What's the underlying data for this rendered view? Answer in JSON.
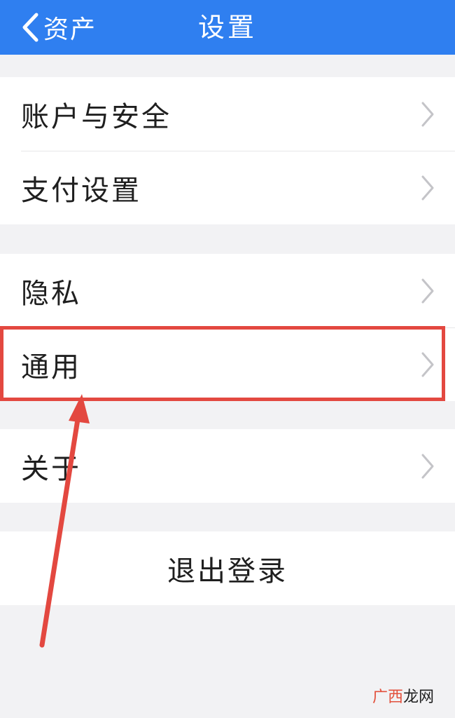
{
  "header": {
    "back_label": "资产",
    "title": "设置"
  },
  "groups": [
    {
      "items": [
        {
          "label": "账户与安全"
        },
        {
          "label": "支付设置"
        }
      ]
    },
    {
      "items": [
        {
          "label": "隐私"
        },
        {
          "label": "通用"
        }
      ]
    },
    {
      "items": [
        {
          "label": "关于"
        }
      ]
    }
  ],
  "logout_label": "退出登录",
  "highlight_target": "通用",
  "watermark": {
    "part1": "广西",
    "part2": "龙网"
  },
  "colors": {
    "navbar": "#2f7ff0",
    "background": "#f2f2f4",
    "annotation": "#e34840"
  },
  "icons": [
    "chevron-left-icon",
    "chevron-right-icon",
    "annotation-arrow"
  ]
}
